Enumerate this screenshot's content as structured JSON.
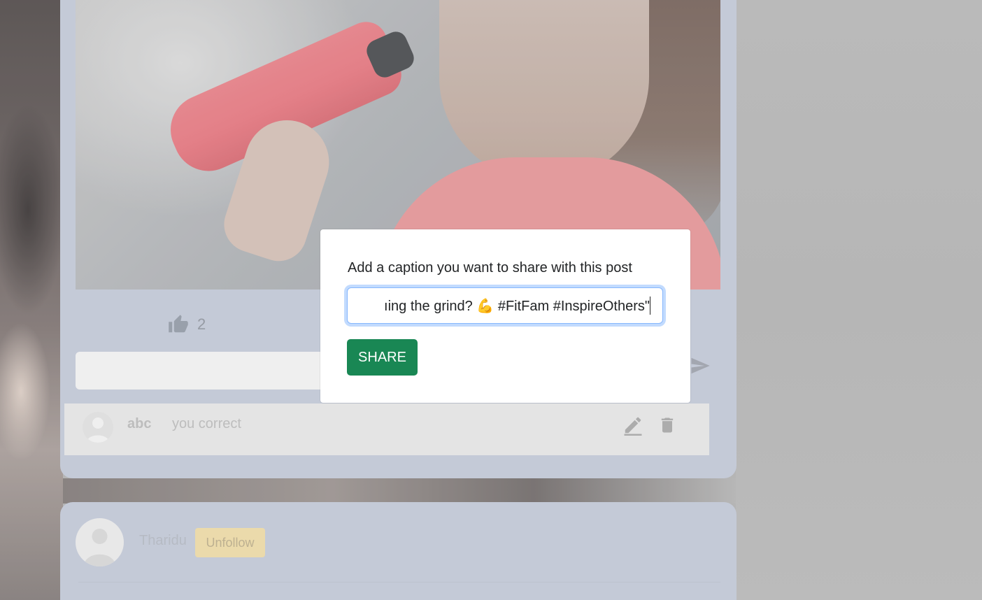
{
  "post": {
    "like_count": "2",
    "comment": {
      "author": "abc",
      "text": "you correct"
    }
  },
  "next_post": {
    "username": "Tharidu",
    "follow_button_label": "Unfollow"
  },
  "share_modal": {
    "label": "Add a caption you want to share with this post",
    "caption_value": "ıing the grind? 💪 #FitFam #InspireOthers\"",
    "share_button_label": "SHARE"
  },
  "colors": {
    "card_bg": "#cfd5e4",
    "share_button": "#198754",
    "unfollow_button": "#fbe8b2",
    "focus_ring": "#86b7fe"
  },
  "icons": [
    "thumbs-up-icon",
    "send-icon",
    "edit-icon",
    "trash-icon",
    "user-avatar-icon"
  ]
}
